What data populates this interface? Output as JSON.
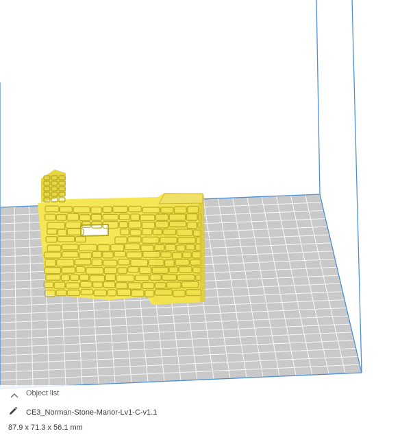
{
  "viewport": {
    "build_plate_color": "#c9c9c9",
    "grid_line_color": "#ffffff",
    "build_volume_edge_color": "#4a8fd8",
    "model_color": "#f5e655",
    "model_shadow_color": "#b8a820"
  },
  "object_panel": {
    "header_label": "Object list",
    "collapse_icon": "chevron-up-icon",
    "edit_icon": "pencil-icon",
    "object_name": "CE3_Norman-Stone-Manor-Lv1-C-v1.1",
    "dimensions": "87.9 x 71.3 x 56.1 mm"
  }
}
